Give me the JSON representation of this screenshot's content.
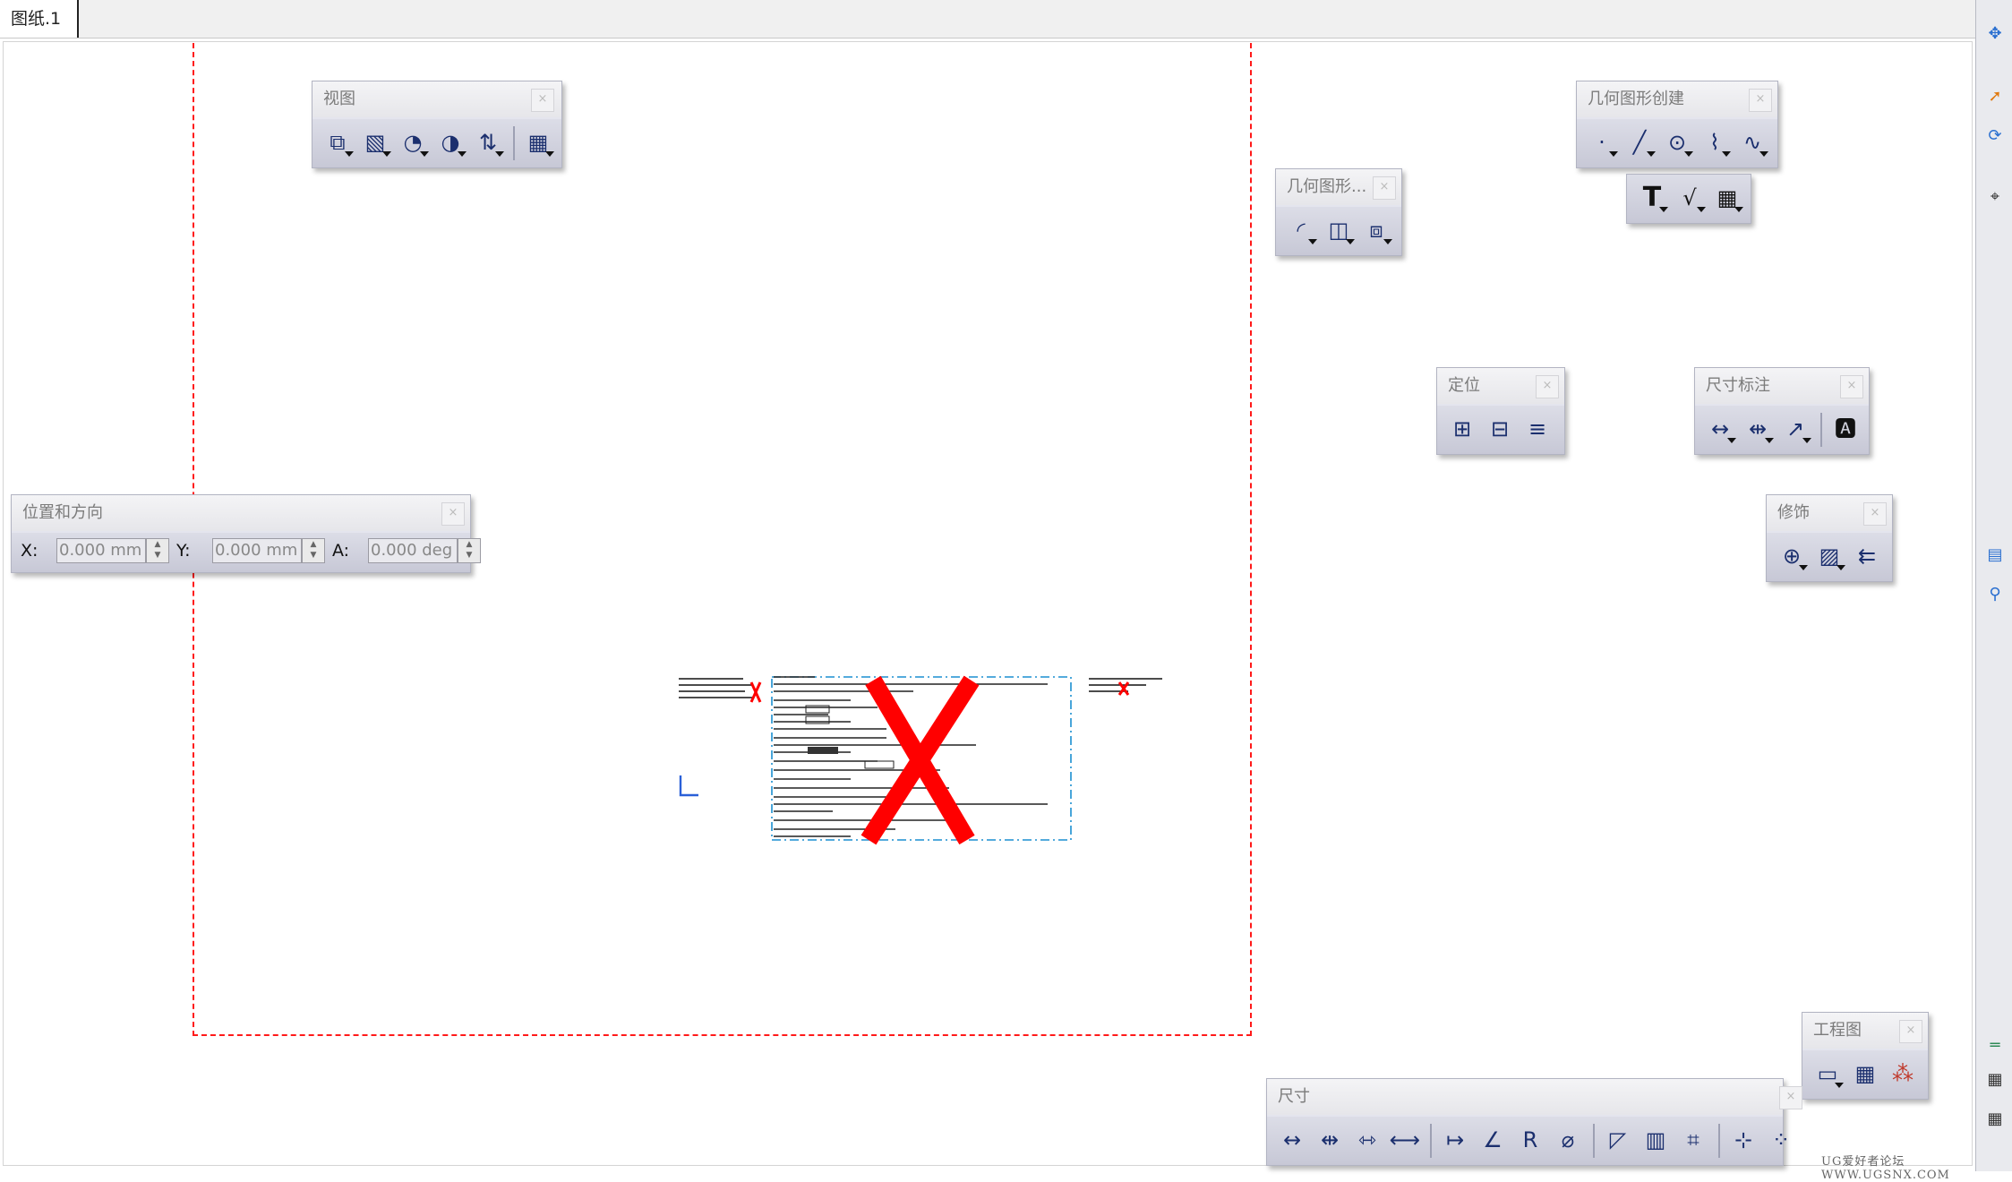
{
  "tab": {
    "label": "图纸.1"
  },
  "toolbars": {
    "view": {
      "title": "视图",
      "close": "×"
    },
    "geometry": {
      "title": "几何图形...",
      "close": "×"
    },
    "geometry_creation": {
      "title": "几何图形创建",
      "close": "×"
    },
    "positioning": {
      "title": "定位",
      "close": "×"
    },
    "dimensioning": {
      "title": "尺寸标注",
      "close": "×"
    },
    "dress_up": {
      "title": "修饰",
      "close": "×"
    },
    "drawing": {
      "title": "工程图",
      "close": "×"
    },
    "dimensions": {
      "title": "尺寸",
      "close": "×"
    },
    "position_orientation": {
      "title": "位置和方向",
      "close": "×",
      "x_label": "X:",
      "x_value": "0.000 mm",
      "y_label": "Y:",
      "y_value": "0.000 mm",
      "a_label": "A:",
      "a_value": "0.000 deg"
    }
  },
  "text_tool": {
    "label": "T"
  },
  "watermark": "UG爱好者论坛 WWW.UGSNX.COM",
  "colors": {
    "frame": "#ff1a1a",
    "toolbar_bg": "#d2d3df",
    "missing_x": "#ff0000",
    "view_frame": "#1c8fd0"
  }
}
